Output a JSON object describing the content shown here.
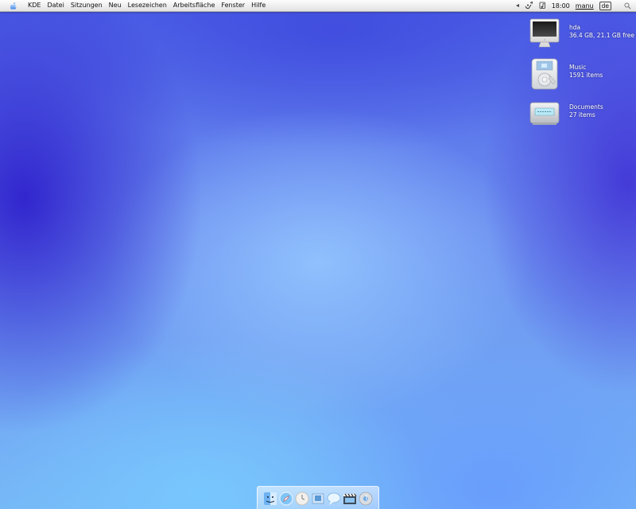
{
  "menubar": {
    "apple_icon": "apple-icon",
    "items": [
      "KDE",
      "Datei",
      "Sitzungen",
      "Neu",
      "Lesezeichen",
      "Arbeitsfläche",
      "Fenster",
      "Hilfe"
    ],
    "tray": {
      "clock": "18:00",
      "user": "manu",
      "keyboard_layout": "de",
      "icons": [
        "expand-arrow-icon",
        "network-icon",
        "music-note-icon",
        "search-icon"
      ]
    }
  },
  "desktop_icons": [
    {
      "icon": "monitor-drive-icon",
      "name": "hda",
      "detail": "36.4 GB, 21.1 GB free"
    },
    {
      "icon": "ipod-music-icon",
      "name": "Music",
      "detail": "1591 items"
    },
    {
      "icon": "documents-drive-icon",
      "name": "Documents",
      "detail": "27 items"
    }
  ],
  "dock": {
    "items": [
      "finder-icon",
      "safari-compass-icon",
      "clock-icon",
      "photo-icon",
      "chat-bubble-icon",
      "clapperboard-icon",
      "itunes-icon"
    ]
  },
  "colors": {
    "menubar_bg": "#ececec",
    "desktop_blue": "#5a7cf0",
    "desktop_light": "#9cc8fb",
    "icon_text": "#ffffff"
  }
}
